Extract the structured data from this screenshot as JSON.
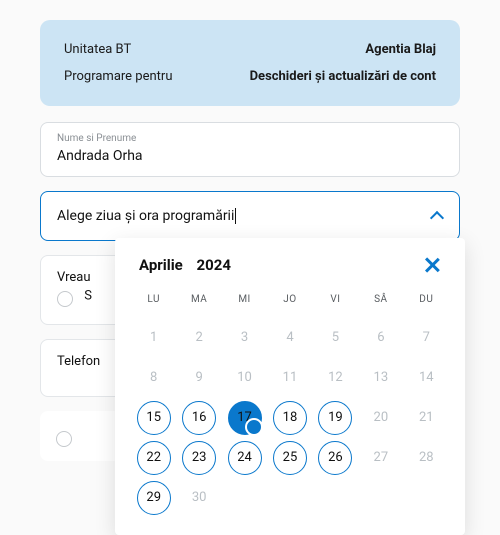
{
  "summary": {
    "unit_label": "Unitatea BT",
    "unit_value": "Agentia Blaj",
    "purpose_label": "Programare pentru",
    "purpose_value": "Deschideri și actualizări de cont"
  },
  "name_field": {
    "label": "Nume si Prenume",
    "value": "Andrada Orha"
  },
  "datetime_field": {
    "placeholder": "Alege ziua și ora programării"
  },
  "backdrop": {
    "want_label": "Vreau",
    "option1_partial": "S",
    "phone_label": "Telefon"
  },
  "calendar": {
    "month": "Aprilie",
    "year": "2024",
    "dow": [
      "LU",
      "MA",
      "MI",
      "JO",
      "VI",
      "SÂ",
      "DU"
    ],
    "days": [
      {
        "n": 1,
        "state": "disabled"
      },
      {
        "n": 2,
        "state": "disabled"
      },
      {
        "n": 3,
        "state": "disabled"
      },
      {
        "n": 4,
        "state": "disabled"
      },
      {
        "n": 5,
        "state": "disabled"
      },
      {
        "n": 6,
        "state": "disabled"
      },
      {
        "n": 7,
        "state": "disabled"
      },
      {
        "n": 8,
        "state": "disabled"
      },
      {
        "n": 9,
        "state": "disabled"
      },
      {
        "n": 10,
        "state": "disabled"
      },
      {
        "n": 11,
        "state": "disabled"
      },
      {
        "n": 12,
        "state": "disabled"
      },
      {
        "n": 13,
        "state": "disabled"
      },
      {
        "n": 14,
        "state": "disabled"
      },
      {
        "n": 15,
        "state": "available"
      },
      {
        "n": 16,
        "state": "available"
      },
      {
        "n": 17,
        "state": "selected"
      },
      {
        "n": 18,
        "state": "available"
      },
      {
        "n": 19,
        "state": "available"
      },
      {
        "n": 20,
        "state": "disabled"
      },
      {
        "n": 21,
        "state": "disabled"
      },
      {
        "n": 22,
        "state": "available"
      },
      {
        "n": 23,
        "state": "available"
      },
      {
        "n": 24,
        "state": "available"
      },
      {
        "n": 25,
        "state": "available"
      },
      {
        "n": 26,
        "state": "available"
      },
      {
        "n": 27,
        "state": "disabled"
      },
      {
        "n": 28,
        "state": "disabled"
      },
      {
        "n": 29,
        "state": "available"
      },
      {
        "n": 30,
        "state": "disabled"
      }
    ]
  }
}
